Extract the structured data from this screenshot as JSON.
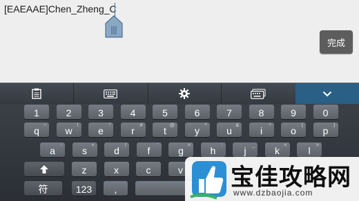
{
  "editor": {
    "text": "[EAEAAE]Chen_Zheng_C",
    "done_label": "完成"
  },
  "toolbar": {
    "items": [
      {
        "icon": "clipboard-icon"
      },
      {
        "icon": "keyboard-icon"
      },
      {
        "icon": "gear-icon"
      },
      {
        "icon": "keyboard-layout-icon"
      },
      {
        "icon": "chevron-down-icon"
      }
    ]
  },
  "keyboard": {
    "row1": [
      "1",
      "2",
      "3",
      "4",
      "5",
      "6",
      "7",
      "8",
      "9",
      "0"
    ],
    "row2": [
      {
        "k": "q",
        "s": "~"
      },
      {
        "k": "w",
        "s": "!"
      },
      {
        "k": "e",
        "s": "\""
      },
      {
        "k": "r",
        "s": "#"
      },
      {
        "k": "t",
        "s": "@"
      },
      {
        "k": "y",
        "s": "^"
      },
      {
        "k": "u",
        "s": "&"
      },
      {
        "k": "i",
        "s": "*"
      },
      {
        "k": "o",
        "s": "("
      },
      {
        "k": "p",
        "s": ")"
      }
    ],
    "row3": [
      {
        "k": "a",
        "s": "-"
      },
      {
        "k": "s",
        "s": "+"
      },
      {
        "k": "d",
        "s": "/"
      },
      {
        "k": "f",
        "s": "'"
      },
      {
        "k": "g",
        "s": "="
      },
      {
        "k": "h",
        "s": ":"
      },
      {
        "k": "j",
        "s": "_"
      },
      {
        "k": "k",
        "s": "<"
      },
      {
        "k": "l",
        "s": ">"
      }
    ],
    "row4": [
      {
        "k": "z",
        "s": ""
      },
      {
        "k": "x",
        "s": ""
      },
      {
        "k": "c",
        "s": ""
      },
      {
        "k": "v",
        "s": ""
      }
    ],
    "row5": {
      "symbol_label": "符",
      "numeric_label": "123",
      "comma_label": ","
    }
  },
  "watermark": {
    "title": "宝佳攻略网",
    "url": "www.dzbaojia.com"
  },
  "colors": {
    "editor_bg": "#eeeeee",
    "key_bg": "#6a7078",
    "keyboard_bg": "#33373d",
    "toolbar_active": "#2a5f86"
  }
}
